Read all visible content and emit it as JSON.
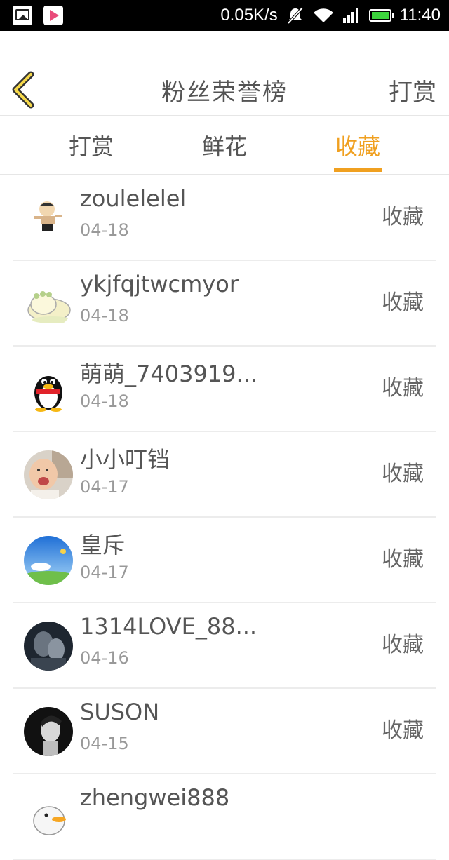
{
  "status_bar": {
    "speed": "0.05K/s",
    "time": "11:40",
    "icons": [
      "gallery-icon",
      "play-store-icon",
      "mute-icon",
      "wifi-icon",
      "signal-icon",
      "battery-icon"
    ]
  },
  "header": {
    "title": "粉丝荣誉榜",
    "right_action": "打赏",
    "back_icon": "chevron-left-icon"
  },
  "tabs": [
    {
      "label": "打赏",
      "active": false
    },
    {
      "label": "鲜花",
      "active": false
    },
    {
      "label": "收藏",
      "active": true
    }
  ],
  "colors": {
    "accent": "#f0a020",
    "text": "#555555",
    "muted": "#999999"
  },
  "list": [
    {
      "name": "zoulelelel",
      "date": "04-18",
      "type": "收藏",
      "avatar": "cartoon-kid"
    },
    {
      "name": "ykjfqjtwcmyor",
      "date": "04-18",
      "type": "收藏",
      "avatar": "cartoon-sheep"
    },
    {
      "name": "萌萌_7403919...",
      "date": "04-18",
      "type": "收藏",
      "avatar": "qq-penguin"
    },
    {
      "name": "小小叮铛",
      "date": "04-17",
      "type": "收藏",
      "avatar": "baby-photo"
    },
    {
      "name": "皇斥",
      "date": "04-17",
      "type": "收藏",
      "avatar": "sky-photo"
    },
    {
      "name": "1314LOVE_88...",
      "date": "04-16",
      "type": "收藏",
      "avatar": "couple-photo"
    },
    {
      "name": "SUSON",
      "date": "04-15",
      "type": "收藏",
      "avatar": "portrait-photo"
    },
    {
      "name": "zhengwei888",
      "date": "",
      "type": "",
      "avatar": "cartoon-duck"
    }
  ]
}
